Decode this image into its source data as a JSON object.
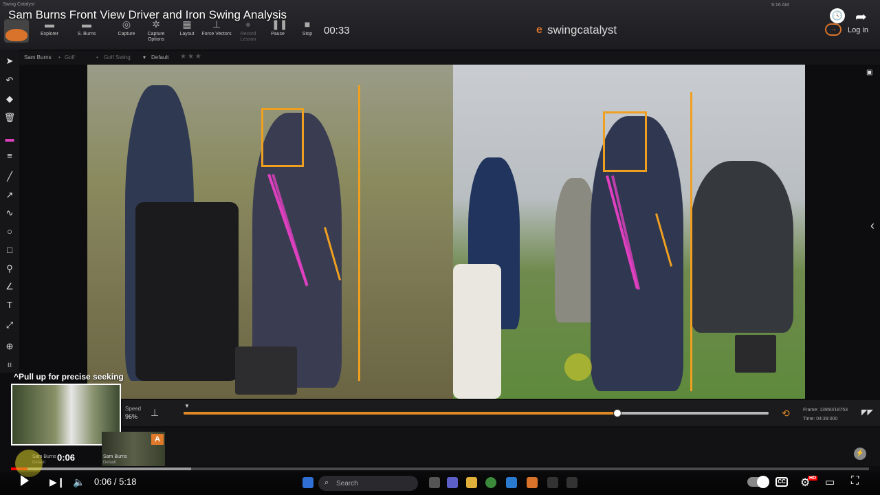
{
  "video": {
    "title": "Sam Burns Front View Driver and Iron Swing Analysis",
    "share_label": "Share",
    "current_time": "0:06",
    "time_display": "0:06 / 5:18",
    "seek_hint": "Pull up for precise seeking",
    "hover_time": "0:06",
    "played_fraction": 0.019,
    "buffered_fraction": 0.21
  },
  "app": {
    "window_label": "Swing Catalyst",
    "system_time": "9:16 AM",
    "brand_mark": "e",
    "brand_text": "swingcatalyst",
    "login_label": "Log in",
    "timer": "00:33",
    "toolbar": [
      {
        "label": "Explorer",
        "icon": "folder-icon",
        "glyph": "▬",
        "enabled": true
      },
      {
        "label": "S. Burns",
        "icon": "user-icon",
        "glyph": "▬",
        "enabled": true
      },
      {
        "label": "Capture",
        "icon": "capture-icon",
        "glyph": "◎",
        "enabled": true
      },
      {
        "label": "Capture Options",
        "icon": "gear-icon",
        "glyph": "✲",
        "enabled": true
      },
      {
        "label": "Layout",
        "icon": "layout-icon",
        "glyph": "▦",
        "enabled": true
      },
      {
        "label": "Force Vectors",
        "icon": "force-vectors-icon",
        "glyph": "⊥",
        "enabled": true
      },
      {
        "label": "Record Lesson",
        "icon": "record-icon",
        "glyph": "●",
        "enabled": false
      },
      {
        "label": "Pause",
        "icon": "pause-icon",
        "glyph": "❚❚",
        "enabled": true
      },
      {
        "label": "Stop",
        "icon": "stop-icon",
        "glyph": "■",
        "enabled": true
      }
    ]
  },
  "breadcrumb": {
    "player": "Sam Burns",
    "sport": "Golf",
    "activity": "Golf Swing",
    "layout": "Default"
  },
  "left_tools": [
    {
      "name": "pointer-icon",
      "glyph": "➤"
    },
    {
      "name": "undo-icon",
      "glyph": "↶"
    },
    {
      "name": "eraser-icon",
      "glyph": "◆"
    },
    {
      "name": "trash-icon",
      "glyph": "🗑"
    },
    {
      "name": "color-icon",
      "glyph": "▬"
    },
    {
      "name": "line-width-icon",
      "glyph": "≡"
    },
    {
      "name": "line-tool-icon",
      "glyph": "╱"
    },
    {
      "name": "arrow-tool-icon",
      "glyph": "↗"
    },
    {
      "name": "freehand-tool-icon",
      "glyph": "∿"
    },
    {
      "name": "circle-tool-icon",
      "glyph": "○"
    },
    {
      "name": "rectangle-tool-icon",
      "glyph": "□"
    },
    {
      "name": "skeleton-tool-icon",
      "glyph": "⚲"
    },
    {
      "name": "angle-tool-icon",
      "glyph": "∠"
    },
    {
      "name": "text-tool-icon",
      "glyph": "T"
    },
    {
      "name": "measure-tool-icon",
      "glyph": "⤢"
    },
    {
      "name": "zoom-tool-icon",
      "glyph": "⊕"
    },
    {
      "name": "crop-tool-icon",
      "glyph": "⌗"
    }
  ],
  "playback": {
    "speed_label": "Speed",
    "speed_value": "96%",
    "progress_fraction": 0.74,
    "frame_label": "Frame: 13950/18753",
    "time_label": "Time:",
    "time_value": "04:39:000"
  },
  "clips": [
    {
      "name": "Sam Burns",
      "sub": "Default"
    },
    {
      "name": "Sam Burns",
      "sub": "Default",
      "badge": "A"
    }
  ],
  "taskbar": {
    "search_label": "Search"
  },
  "colors": {
    "accent": "#e08a25",
    "overlay_orange": "#f0a020",
    "overlay_pink": "#e040c0",
    "yt_red": "#ff0000"
  }
}
